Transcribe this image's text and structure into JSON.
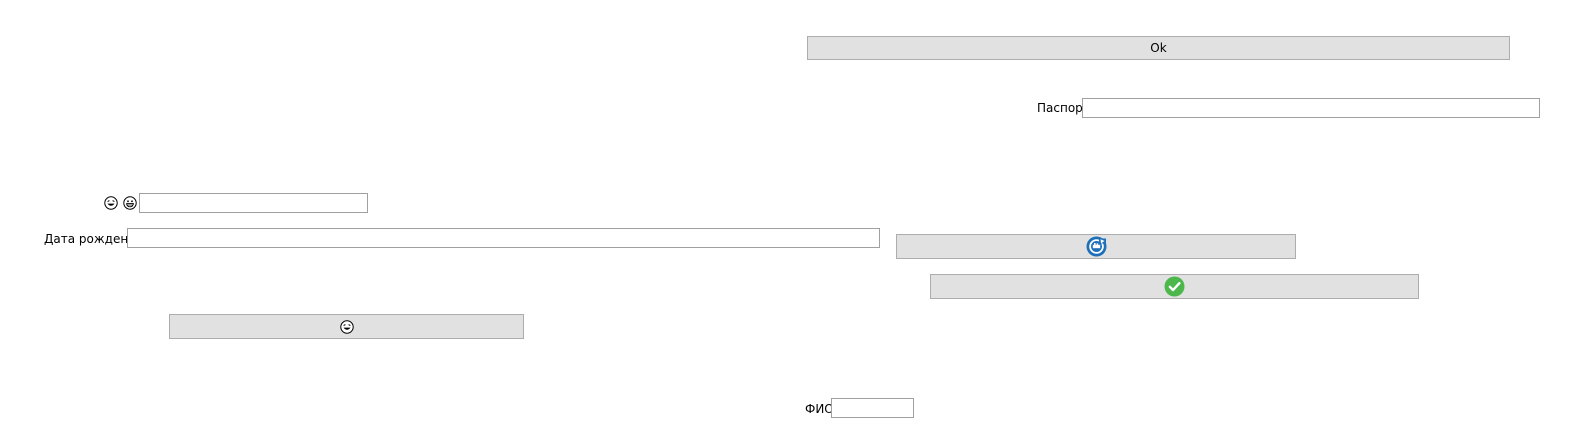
{
  "buttons": {
    "ok_label": "Ok"
  },
  "fields": {
    "passport": {
      "label": "Паспорт",
      "value": ""
    },
    "emoji_field": {
      "label_icons": [
        "laughing-face-icon",
        "grinning-face-icon"
      ],
      "value": ""
    },
    "birth_date": {
      "label": "Дата рождения",
      "value": ""
    },
    "fio": {
      "label": "ФИО",
      "value": ""
    }
  },
  "icons": {
    "laughing_button_icon": "laughing-face-icon",
    "refresh_button_icon": "refresh-badge-icon",
    "check_button_icon": "checkmark-circle-icon"
  },
  "colors": {
    "button_bg": "#e1e1e1",
    "button_border": "#adadad",
    "field_border": "#a0a0a0",
    "refresh_blue": "#1e6fb8",
    "check_green": "#4cb84c"
  }
}
